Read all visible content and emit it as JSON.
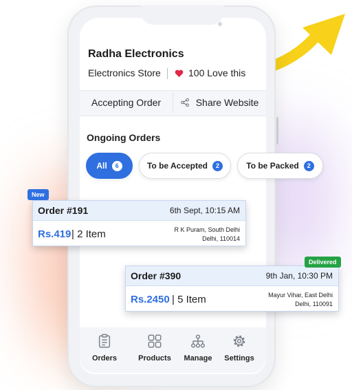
{
  "store": {
    "name": "Radha Electronics",
    "type": "Electronics Store",
    "love_text": "100 Love this"
  },
  "actions": {
    "accepting_label": "Accepting Order",
    "share_label": "Share Website"
  },
  "ongoing": {
    "title": "Ongoing Orders",
    "filters": [
      {
        "label": "All",
        "count": "6",
        "active": true
      },
      {
        "label": "To be Accepted",
        "count": "2",
        "active": false
      },
      {
        "label": "To be Packed",
        "count": "2",
        "active": false
      }
    ]
  },
  "orders": [
    {
      "tag": "New",
      "id": "Order #191",
      "time": "6th Sept, 10:15 AM",
      "amount": "Rs.419",
      "items": "| 2 Item",
      "address_line1": "R K Puram, South Delhi",
      "address_line2": "Delhi, 110014"
    },
    {
      "tag": "Delivered",
      "id": "Order #390",
      "time": "9th Jan, 10:30 PM",
      "amount": "Rs.2450",
      "items": "| 5 Item",
      "address_line1": "Mayur Vihar, East Delhi",
      "address_line2": "Delhi, 110091"
    }
  ],
  "nav": [
    {
      "label": "Orders",
      "icon": "clipboard-icon"
    },
    {
      "label": "Products",
      "icon": "grid-icon"
    },
    {
      "label": "Manage",
      "icon": "hierarchy-icon"
    },
    {
      "label": "Settings",
      "icon": "gear-icon"
    }
  ],
  "colors": {
    "accent": "#2f6fe0",
    "heart": "#e0284a",
    "delivered": "#25a244",
    "arrow": "#f7d11a"
  }
}
